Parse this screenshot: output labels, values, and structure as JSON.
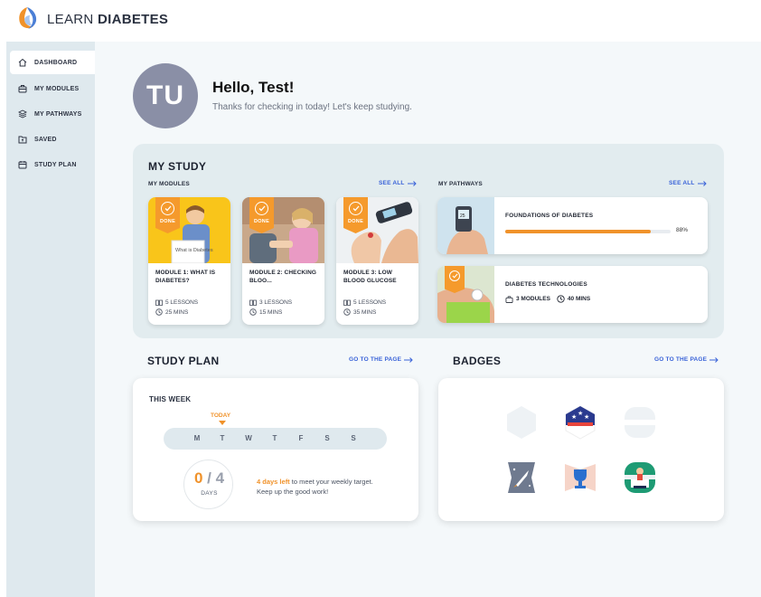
{
  "header": {
    "brand_light": "LEARN",
    "brand_bold": "DIABETES"
  },
  "sidebar": {
    "items": [
      {
        "label": "DASHBOARD",
        "icon": "home-icon",
        "active": true
      },
      {
        "label": "MY MODULES",
        "icon": "briefcase-icon",
        "active": false
      },
      {
        "label": "MY PATHWAYS",
        "icon": "layers-icon",
        "active": false
      },
      {
        "label": "SAVED",
        "icon": "folder-icon",
        "active": false
      },
      {
        "label": "STUDY PLAN",
        "icon": "calendar-icon",
        "active": false
      }
    ]
  },
  "user": {
    "initials": "TU",
    "greeting": "Hello, Test!",
    "subtitle": "Thanks for checking in today! Let's keep studying."
  },
  "my_study": {
    "title": "MY STUDY",
    "modules_label": "MY MODULES",
    "modules_link": "SEE ALL",
    "pathways_label": "MY PATHWAYS",
    "pathways_link": "SEE ALL",
    "modules": [
      {
        "status": "DONE",
        "title": "MODULE 1: WHAT IS DIABETES?",
        "lessons": "5 LESSONS",
        "duration": "25 MINS",
        "sign_text": "What is Diabetes"
      },
      {
        "status": "DONE",
        "title": "MODULE 2: CHECKING BLOO...",
        "lessons": "3 LESSONS",
        "duration": "15 MINS"
      },
      {
        "status": "DONE",
        "title": "MODULE 3: LOW BLOOD GLUCOSE",
        "lessons": "5 LESSONS",
        "duration": "35 MINS"
      }
    ],
    "pathways": [
      {
        "title": "FOUNDATIONS OF DIABETES",
        "progress_pct": 88,
        "progress_label": "88%",
        "meter_value": "25"
      },
      {
        "title": "DIABETES TECHNOLOGIES",
        "modules": "3 MODULES",
        "duration": "40 MINS"
      }
    ]
  },
  "study_plan": {
    "title": "STUDY PLAN",
    "link": "GO TO THE PAGE",
    "week_label": "THIS WEEK",
    "today_label": "TODAY",
    "days": [
      "M",
      "T",
      "W",
      "T",
      "F",
      "S",
      "S"
    ],
    "completed": "0",
    "target": "4",
    "days_label": "DAYS",
    "message_highlight": "4 days left",
    "message_rest": " to meet your weekly target. Keep up the good work!"
  },
  "badges": {
    "title": "BADGES",
    "link": "GO TO THE PAGE",
    "items": [
      {
        "icon": "hexagon-badge-icon",
        "earned": false
      },
      {
        "icon": "stars-badge-icon",
        "earned": true
      },
      {
        "icon": "rounded-badge-icon",
        "earned": false
      },
      {
        "icon": "rocket-badge-icon",
        "earned": true
      },
      {
        "icon": "trophy-badge-icon",
        "earned": true
      },
      {
        "icon": "certificate-badge-icon",
        "earned": true
      }
    ]
  },
  "colors": {
    "accent": "#f0922a",
    "link": "#3a63d8",
    "sidebar_bg": "#dfe9ee",
    "panel_bg": "#e2ecef",
    "avatar_bg": "#8a8fa6"
  }
}
